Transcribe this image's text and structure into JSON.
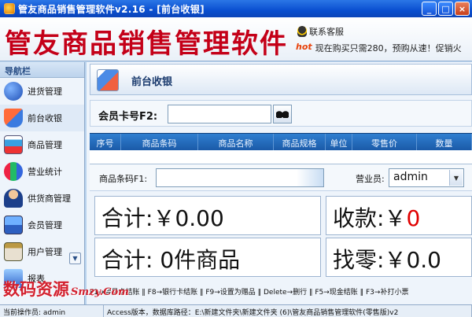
{
  "window": {
    "title": "管友商品销售管理软件v2.16 - [前台收银]",
    "buttons": {
      "minimize": "_",
      "maximize": "□",
      "close": "×"
    }
  },
  "header": {
    "brand": "管友商品销售管理软件",
    "service": "联系客服",
    "hot": "hot",
    "promo": "现在购买只需280，预购从速！促销火"
  },
  "sidebar": {
    "title": "导航栏",
    "items": [
      {
        "label": "进货管理",
        "icon": "stock-icon"
      },
      {
        "label": "前台收银",
        "icon": "cart-icon"
      },
      {
        "label": "商品管理",
        "icon": "goods-icon"
      },
      {
        "label": "营业统计",
        "icon": "stats-icon"
      },
      {
        "label": "供货商管理",
        "icon": "supplier-icon"
      },
      {
        "label": "会员管理",
        "icon": "member-icon"
      },
      {
        "label": "用户管理",
        "icon": "user-icon"
      },
      {
        "label": "报表",
        "icon": "report-icon"
      }
    ]
  },
  "page": {
    "title": "前台收银",
    "member_card_label": "会员卡号F2:",
    "member_card_value": "",
    "columns": [
      "序号",
      "商品条码",
      "商品名称",
      "商品规格",
      "单位",
      "零售价",
      "数量"
    ],
    "barcode_label": "商品条码F1:",
    "barcode_value": "",
    "clerk_label": "营业员:",
    "clerk_value": "admin",
    "total_label": "合计:",
    "total_amount": "￥0.00",
    "received_label": "收款:",
    "received_currency": "￥",
    "received_amount": "0",
    "items_label": "合计:",
    "items_value": "0件商品",
    "change_label": "找零:",
    "change_amount": "￥0.0"
  },
  "shortcuts": "F1→会员卡结账 ‖ F8→银行卡结账 ‖ F9→设置为赠品 ‖ Delete→删行 ‖ F5→现金结账 ‖ F3→补打小票",
  "watermark": {
    "cn": "数码资源",
    "en": "Smzy.Com"
  },
  "status": {
    "operator": "当前操作员: admin",
    "path": "Access版本，数据库路径：E:\\新建文件夹\\新建文件夹 (6)\\管友商品销售管理软件(零售版)v2"
  }
}
